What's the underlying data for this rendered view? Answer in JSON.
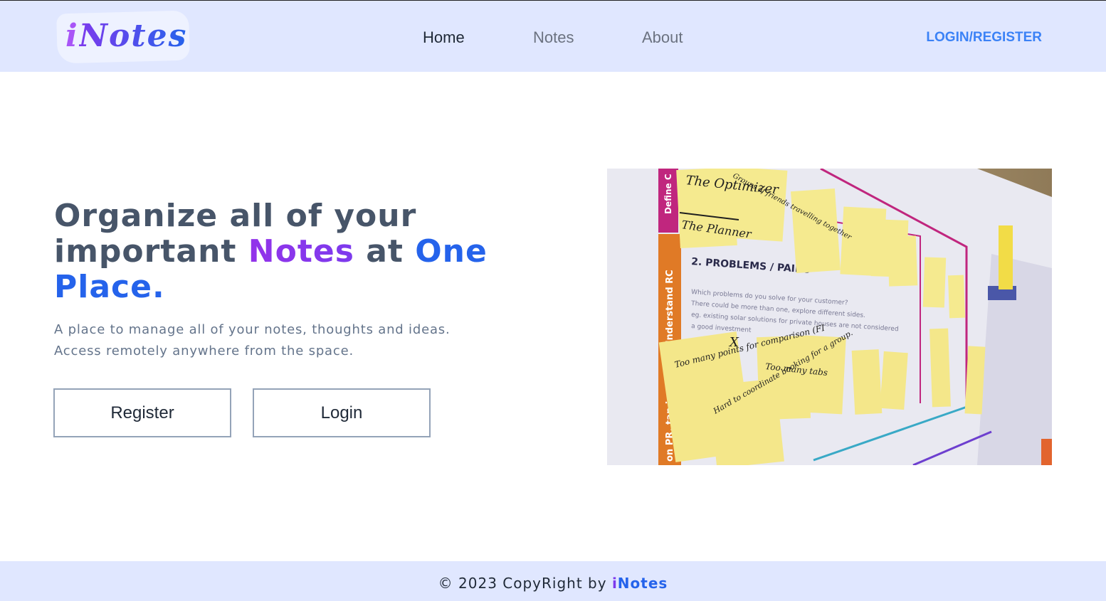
{
  "header": {
    "logo": {
      "prefix": "i",
      "rest": "Notes"
    },
    "nav": [
      {
        "label": "Home",
        "active": true
      },
      {
        "label": "Notes",
        "active": false
      },
      {
        "label": "About",
        "active": false
      }
    ],
    "auth_link": "LOGIN/REGISTER"
  },
  "hero": {
    "headline": {
      "part1": "Organize all of your important ",
      "highlight1": "Notes",
      "part2": " at ",
      "highlight2": "One Place."
    },
    "subtext": {
      "line1": "A place to manage all of your notes, thoughts and ideas.",
      "line2": "Access remotely anywhere from the space."
    },
    "buttons": {
      "register": "Register",
      "login": "Login"
    },
    "image": {
      "sticky_notes": [
        "The Optimizer",
        "The Planner",
        "Groups of friends travelling together",
        "Too many points for comparison (FI",
        "Hard to coordinate booking for a group.",
        "Too many tabs"
      ],
      "board_labels": [
        "Define C",
        "Understand RC",
        "on PR, tap in",
        "2. PROBLEMS / PAINS"
      ],
      "board_text": [
        "Which problems do you solve for your customer?",
        "There could be more than one, explore different sides.",
        "eg. existing solar solutions for private houses are not considered",
        "a good investment"
      ],
      "close_mark": "X"
    }
  },
  "footer": {
    "text": "© 2023 CopyRight by ",
    "brand_prefix": "i",
    "brand_rest": "Notes"
  },
  "colors": {
    "header_bg": "#e0e7ff",
    "accent_blue": "#2563eb",
    "accent_purple": "#7c3aed",
    "text_slate": "#475569"
  }
}
